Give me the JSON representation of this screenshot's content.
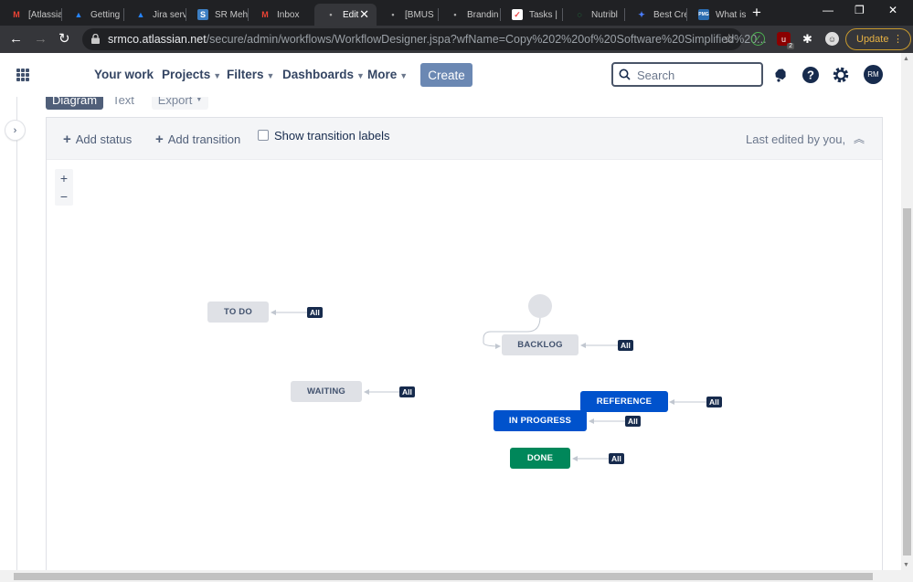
{
  "browser": {
    "tabs": [
      {
        "title": "[Atlassia",
        "icon": "gmail-icon"
      },
      {
        "title": "Getting",
        "icon": "atlassian-icon"
      },
      {
        "title": "Jira serv",
        "icon": "atlassian-icon"
      },
      {
        "title": "SR Meh",
        "icon": "s-icon"
      },
      {
        "title": "Inbox",
        "icon": "gmail-icon"
      },
      {
        "title": "Edit",
        "icon": "loading-icon"
      },
      {
        "title": "[BMUS",
        "icon": "loading-icon"
      },
      {
        "title": "Brandin",
        "icon": "loading-icon"
      },
      {
        "title": "Tasks |",
        "icon": "tasks-icon"
      },
      {
        "title": "Nutribl",
        "icon": "loading-icon"
      },
      {
        "title": "Best Cre",
        "icon": "sparkle-icon"
      },
      {
        "title": "What is",
        "icon": "pmg-icon"
      }
    ],
    "url_host": "srmco.atlassian.net",
    "url_path": "/secure/admin/workflows/WorkflowDesigner.jspa?wfName=Copy%202%20of%20Software%20Simplified%20...",
    "update_label": "Update",
    "ext_badge": "2",
    "s_glyph": "S",
    "pmg_glyph": "PMG"
  },
  "jira": {
    "nav": {
      "your_work": "Your work",
      "projects": "Projects",
      "filters": "Filters",
      "dashboards": "Dashboards",
      "more": "More",
      "create": "Create",
      "search_placeholder": "Search",
      "avatar_initials": "RM"
    },
    "view_tabs": {
      "diagram": "Diagram",
      "text": "Text",
      "export": "Export"
    },
    "designer": {
      "add_status": "Add status",
      "add_transition": "Add transition",
      "show_transition_labels": "Show transition labels",
      "last_edited": "Last edited by you,",
      "zoom_in": "+",
      "zoom_out": "−"
    },
    "statuses": [
      {
        "name": "TO DO",
        "category": "grey",
        "badge": "All"
      },
      {
        "name": "BACKLOG",
        "category": "grey",
        "badge": "All"
      },
      {
        "name": "WAITING",
        "category": "grey",
        "badge": "All"
      },
      {
        "name": "REFERENCE",
        "category": "blue",
        "badge": "All"
      },
      {
        "name": "IN PROGRESS",
        "category": "blue",
        "badge": "All"
      },
      {
        "name": "DONE",
        "category": "green",
        "badge": "All"
      }
    ],
    "colors": {
      "todo": "#dfe1e6",
      "in_progress": "#0052cc",
      "done": "#00875a",
      "badge": "#172b4d"
    }
  }
}
